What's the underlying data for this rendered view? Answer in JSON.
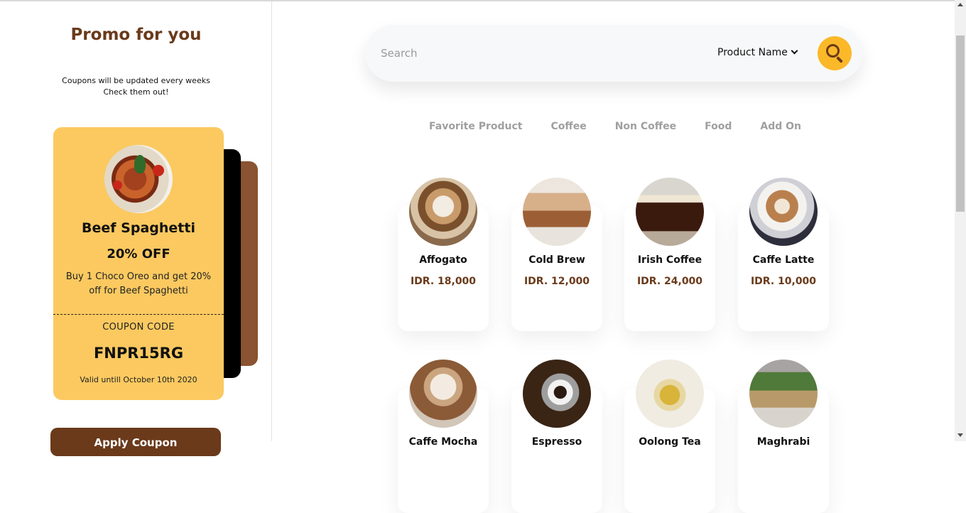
{
  "sidebar": {
    "title": "Promo for you",
    "subtitle_line1": "Coupons will be updated every weeks",
    "subtitle_line2": "Check them out!",
    "coupon": {
      "name": "Beef Spaghetti",
      "discount": "20% OFF",
      "description": "Buy 1 Choco Oreo and get 20% off for Beef Spaghetti",
      "code_label": "COUPON CODE",
      "code": "FNPR15RG",
      "valid": "Valid untill October 10th 2020"
    },
    "apply_label": "Apply Coupon"
  },
  "search": {
    "placeholder": "Search",
    "filter_label": "Product Name"
  },
  "tabs": [
    "Favorite Product",
    "Coffee",
    "Non Coffee",
    "Food",
    "Add On"
  ],
  "products": [
    {
      "name": "Affogato",
      "price": "IDR. 18,000",
      "icon": "affogato-image"
    },
    {
      "name": "Cold Brew",
      "price": "IDR. 12,000",
      "icon": "cold-brew-image"
    },
    {
      "name": "Irish Coffee",
      "price": "IDR. 24,000",
      "icon": "irish-coffee-image"
    },
    {
      "name": "Caffe Latte",
      "price": "IDR. 10,000",
      "icon": "caffe-latte-image"
    },
    {
      "name": "Caffe Mocha",
      "price": "",
      "icon": "caffe-mocha-image"
    },
    {
      "name": "Espresso",
      "price": "",
      "icon": "espresso-image"
    },
    {
      "name": "Oolong Tea",
      "price": "",
      "icon": "oolong-tea-image"
    },
    {
      "name": "Maghrabi",
      "price": "",
      "icon": "maghrabi-image"
    }
  ],
  "colors": {
    "brand_brown": "#6a3a1b",
    "coupon_yellow": "#fbc960",
    "search_button": "#fbb829",
    "tab_text": "#9f9f9f"
  }
}
